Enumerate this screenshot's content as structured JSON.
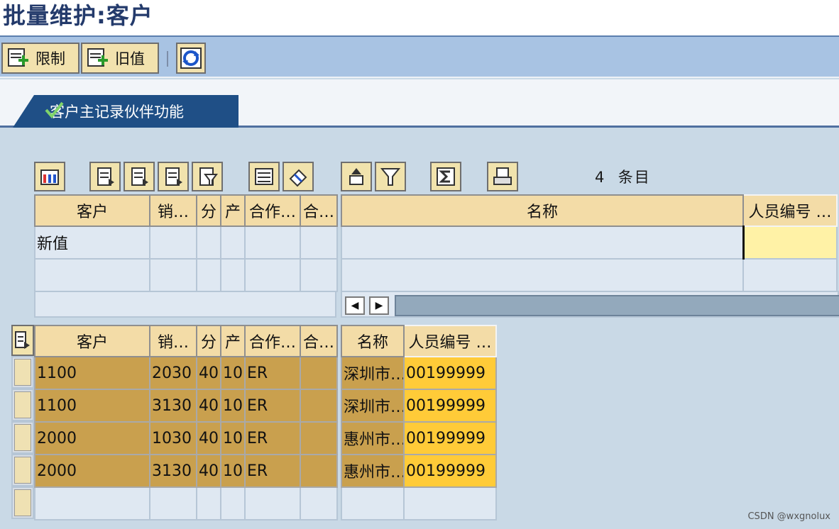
{
  "window": {
    "title": "批量维护:客户"
  },
  "toolbar": {
    "restrict_label": "限制",
    "old_value_label": "旧值"
  },
  "tab": {
    "label": "客户主记录伙伴功能"
  },
  "grid": {
    "entries_count": "4",
    "entries_label": "条目"
  },
  "top_left": {
    "headers": [
      "客户",
      "销…",
      "分",
      "产",
      "合作…",
      "合…"
    ],
    "rows": [
      [
        "新值",
        "",
        "",
        "",
        "",
        ""
      ],
      [
        "",
        "",
        "",
        "",
        "",
        ""
      ]
    ]
  },
  "top_right": {
    "headers": [
      "名称",
      "人员编号 …"
    ],
    "rows": [
      [
        "",
        ""
      ],
      [
        "",
        ""
      ]
    ]
  },
  "bottom_left": {
    "headers": [
      "客户",
      "销…",
      "分",
      "产",
      "合作…",
      "合…"
    ],
    "rows": [
      [
        "1100",
        "2030",
        "40",
        "10",
        "ER",
        ""
      ],
      [
        "1100",
        "3130",
        "40",
        "10",
        "ER",
        ""
      ],
      [
        "2000",
        "1030",
        "40",
        "10",
        "ER",
        ""
      ],
      [
        "2000",
        "3130",
        "40",
        "10",
        "ER",
        ""
      ],
      [
        "",
        "",
        "",
        "",
        "",
        ""
      ]
    ]
  },
  "bottom_right": {
    "headers": [
      "名称",
      "人员编号 …"
    ],
    "rows": [
      [
        "深圳市…",
        "00199999"
      ],
      [
        "深圳市…",
        "00199999"
      ],
      [
        "惠州市…",
        "00199999"
      ],
      [
        "惠州市…",
        "00199999"
      ],
      [
        "",
        ""
      ]
    ]
  },
  "watermark": "CSDN @wxgnolux",
  "colors": {
    "header": "#f3dca7",
    "selected_row": "#c9a04e",
    "highlight": "#ffcb38",
    "toolbar": "#a8c3e3",
    "tab": "#1f4f86"
  }
}
